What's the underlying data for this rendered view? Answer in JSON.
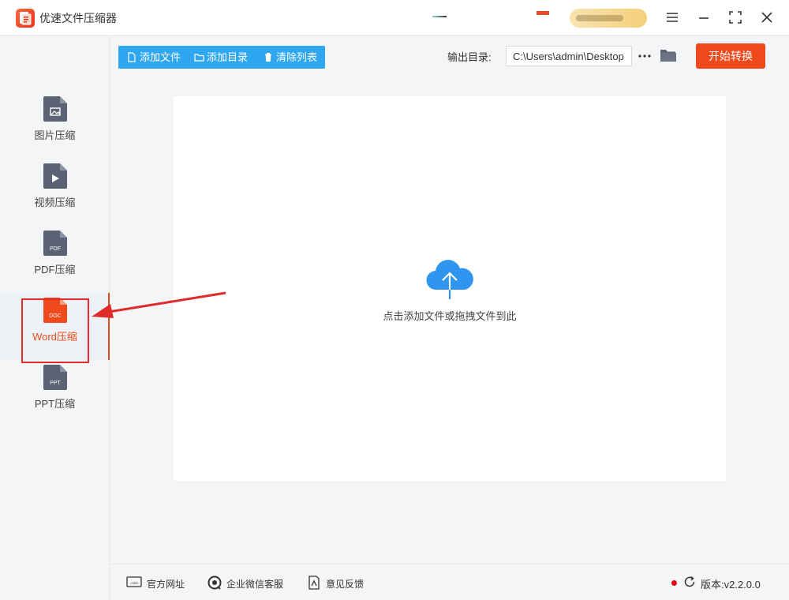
{
  "app": {
    "title": "优速文件压缩器"
  },
  "sidebar": {
    "items": [
      {
        "label": "图片压缩",
        "icon": "image-file-icon",
        "badge": ""
      },
      {
        "label": "视频压缩",
        "icon": "video-file-icon",
        "badge": ""
      },
      {
        "label": "PDF压缩",
        "icon": "pdf-file-icon",
        "badge": "PDF"
      },
      {
        "label": "Word压缩",
        "icon": "doc-file-icon",
        "badge": "DOC",
        "active": true
      },
      {
        "label": "PPT压缩",
        "icon": "ppt-file-icon",
        "badge": "PPT"
      }
    ]
  },
  "toolbar": {
    "add_file": "添加文件",
    "add_folder": "添加目录",
    "clear_list": "清除列表",
    "output_label": "输出目录:",
    "output_path": "C:\\Users\\admin\\Desktop",
    "start": "开始转换"
  },
  "dropzone": {
    "hint": "点击添加文件或拖拽文件到此"
  },
  "footer": {
    "website": "官方网址",
    "wechat": "企业微信客服",
    "feedback": "意见反馈",
    "version": "版本:v2.2.0.0"
  },
  "colors": {
    "accent": "#f0491c",
    "blue": "#2fa6f0",
    "active_text": "#e64a19",
    "icon_dark": "#5a6273"
  }
}
